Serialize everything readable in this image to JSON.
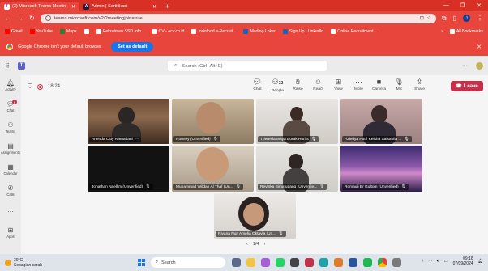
{
  "browser": {
    "tabs": [
      {
        "title": "(3) Microsoft Teams Meetin",
        "active": true
      },
      {
        "title": "Admin | Sertifikasi",
        "active": false
      }
    ],
    "new_tab": "+",
    "url": "teams.microsoft.com/v2/?meetingjoin=true",
    "profile_initial": "J",
    "bookmarks": [
      "Gmail",
      "YouTube",
      "Maps",
      "",
      "Rekrutmen SSD Info...",
      "CV - ocv.co.id",
      "Indofood e-Recruit...",
      "Mading Loker",
      "Sign Up | LinkedIn",
      "Online Recruitment..."
    ],
    "all_bookmarks": "All Bookmarks",
    "infobar_text": "Google Chrome isn't your default browser",
    "set_default": "Set as default"
  },
  "teams": {
    "search_placeholder": "Search (Ctrl+Alt+E)",
    "rail": [
      {
        "label": "Activity",
        "icon": "bell-icon"
      },
      {
        "label": "Chat",
        "icon": "chat-icon",
        "badge": "6"
      },
      {
        "label": "Teams",
        "icon": "teams-icon"
      },
      {
        "label": "Assignments",
        "icon": "assignments-icon"
      },
      {
        "label": "Calendar",
        "icon": "calendar-icon"
      },
      {
        "label": "Calls",
        "icon": "phone-icon"
      },
      {
        "label": "",
        "icon": "more-icon"
      },
      {
        "label": "Apps",
        "icon": "apps-icon"
      }
    ],
    "meeting": {
      "timer": "18:24",
      "tools": [
        {
          "label": "Chat",
          "icon": "chat-icon"
        },
        {
          "label": "People",
          "icon": "people-icon",
          "count": "32"
        },
        {
          "label": "Raise",
          "icon": "hand-icon"
        },
        {
          "label": "React",
          "icon": "smile-icon"
        },
        {
          "label": "View",
          "icon": "grid-icon"
        },
        {
          "label": "More",
          "icon": "more-icon"
        },
        {
          "label": "Camera",
          "icon": "camera-icon"
        },
        {
          "label": "Mic",
          "icon": "mic-icon"
        },
        {
          "label": "Share",
          "icon": "share-icon"
        }
      ],
      "leave": "Leave",
      "participants": [
        "Arienda Citty Ramadani",
        "Rooney (Unverified)",
        "Theresia Maya Burak Hurint",
        "Aziedya Putri Keisha Salsabila ...",
        "Jonathan Naellim (Unverified)",
        "Muhammad Wildan Al Thaf (Un...",
        "Revinka Simatupang (Unverifie...",
        "Romauli Br Gultom (Unverified)",
        "Rivana Nur' Amelia Oktavia (Un..."
      ],
      "pager": "1/4"
    }
  },
  "taskbar": {
    "temp": "30°C",
    "weather": "Sebagian cerah",
    "search": "Search",
    "time": "09:18",
    "date": "07/09/2024"
  }
}
